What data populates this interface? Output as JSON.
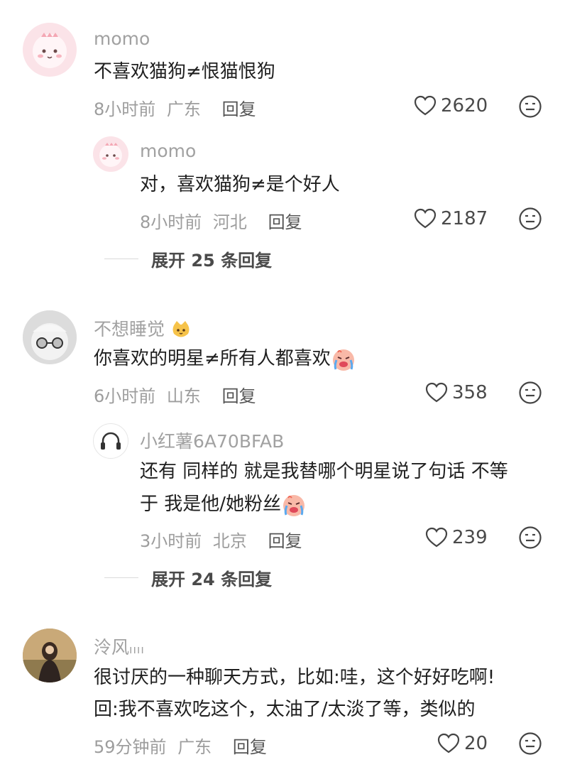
{
  "comments": [
    {
      "username": "momo",
      "text": "不喜欢猫狗≠恨猫恨狗",
      "time": "8小时前",
      "location": "广东",
      "reply_label": "回复",
      "likes": "2620",
      "avatar_icon": "pink-dinosaur-avatar",
      "replies": [
        {
          "username": "momo",
          "text": "对，喜欢猫狗≠是个好人",
          "time": "8小时前",
          "location": "河北",
          "reply_label": "回复",
          "likes": "2187",
          "avatar_icon": "pink-dinosaur-avatar"
        }
      ],
      "expand_label": "展开 25 条回复"
    },
    {
      "username": "不想睡觉",
      "username_emoji": "cat-face-emoji",
      "text": "你喜欢的明星≠所有人都喜欢",
      "text_emoji": "crying-face-emoji",
      "time": "6小时前",
      "location": "山东",
      "reply_label": "回复",
      "likes": "358",
      "avatar_icon": "fluffy-character-avatar",
      "replies": [
        {
          "username": "小红薯6A70BFAB",
          "text_line1": "还有 同样的 就是我替哪个明星说了句话 不等",
          "text_line2": "于 我是他/她粉丝",
          "text_emoji": "crying-face-emoji",
          "time": "3小时前",
          "location": "北京",
          "reply_label": "回复",
          "likes": "239",
          "avatar_icon": "headphones-avatar"
        }
      ],
      "expand_label": "展开 24 条回复"
    },
    {
      "username": "泠风",
      "text_line1": "很讨厌的一种聊天方式，比如:哇，这个好好吃啊!",
      "text_line2": "回:我不喜欢吃这个，太油了/太淡了等，类似的",
      "time": "59分钟前",
      "location": "广东",
      "reply_label": "回复",
      "likes": "20",
      "avatar_icon": "girl-photo-avatar"
    }
  ],
  "colors": {
    "username": "#a1a1a1",
    "text": "#1f1f1f",
    "meta": "#9d9d9d",
    "accent_pink": "#f7c9cf"
  }
}
